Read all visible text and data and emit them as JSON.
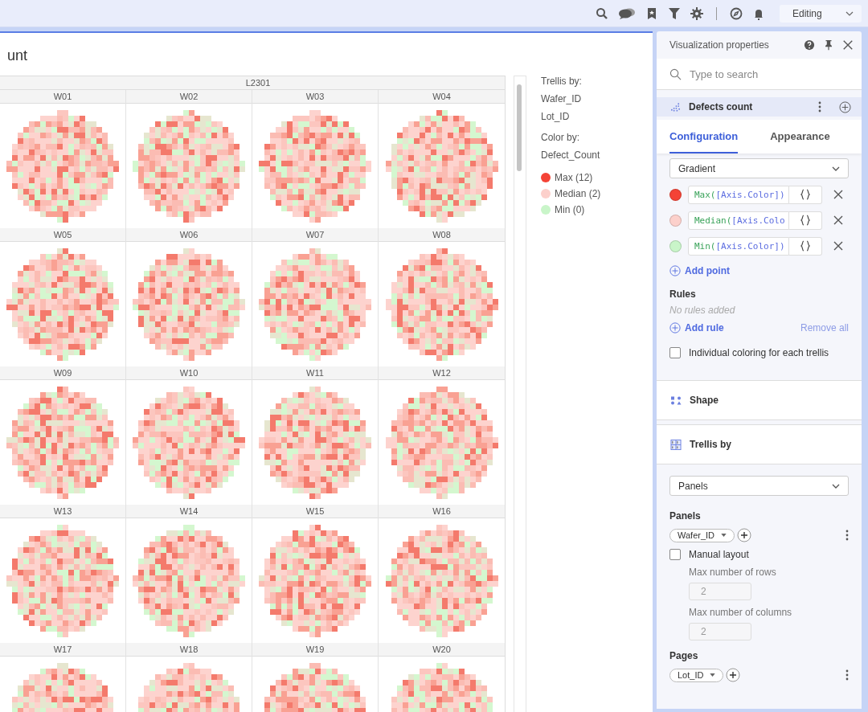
{
  "toolbar": {
    "mode": "Editing"
  },
  "visualization": {
    "title": "unt",
    "lot": "L2301",
    "panels": [
      {
        "label": "W01"
      },
      {
        "label": "W02"
      },
      {
        "label": "W03"
      },
      {
        "label": "W04"
      },
      {
        "label": "W05"
      },
      {
        "label": "W06"
      },
      {
        "label": "W07"
      },
      {
        "label": "W08"
      },
      {
        "label": "W09"
      },
      {
        "label": "W10"
      },
      {
        "label": "W11"
      },
      {
        "label": "W12"
      },
      {
        "label": "W13"
      },
      {
        "label": "W14"
      },
      {
        "label": "W15"
      },
      {
        "label": "W16"
      },
      {
        "label": "W17"
      },
      {
        "label": "W18"
      },
      {
        "label": "W19"
      },
      {
        "label": "W20"
      }
    ],
    "legend": {
      "trellis_title": "Trellis by:",
      "trellis_fields": [
        "Wafer_ID",
        "Lot_ID"
      ],
      "color_title": "Color by:",
      "color_field": "Defect_Count",
      "items": [
        {
          "label": "Max (12)",
          "color": "#f44336"
        },
        {
          "label": "Median (2)",
          "color": "#fcd0cb"
        },
        {
          "label": "Min (0)",
          "color": "#c9f5c9"
        }
      ]
    }
  },
  "properties": {
    "title": "Visualization properties",
    "search": {
      "placeholder": "Type to search"
    },
    "layer": "Defects count",
    "tabs": [
      {
        "label": "Configuration",
        "selected": true
      },
      {
        "label": "Appearance",
        "selected": false
      }
    ],
    "color_mode": "Gradient",
    "color_points": [
      {
        "color": "#f44336",
        "function": "Max(",
        "argument": "[Axis.Color])"
      },
      {
        "color": "#fcd0cb",
        "function": "Median(",
        "argument": "[Axis.Colo"
      },
      {
        "color": "#c9f5c9",
        "function": "Min(",
        "argument": "[Axis.Color])"
      }
    ],
    "add_point": "Add point",
    "rules_title": "Rules",
    "rules_empty": "No rules added",
    "add_rule": "Add rule",
    "remove_all": "Remove all",
    "individual_coloring": {
      "label": "Individual coloring for each trellis",
      "checked": false
    },
    "sections": [
      {
        "kind": "shape",
        "label": "Shape"
      },
      {
        "kind": "trellis",
        "label": "Trellis by"
      }
    ],
    "trellis_mode": "Panels",
    "panels_title": "Panels",
    "panels_chip": "Wafer_ID",
    "manual_layout": {
      "label": "Manual layout",
      "checked": false
    },
    "max_rows": {
      "label": "Max number of rows",
      "value": "2"
    },
    "max_columns": {
      "label": "Max number of columns",
      "value": "2"
    },
    "pages_title": "Pages",
    "pages_chip": "Lot_ID"
  }
}
